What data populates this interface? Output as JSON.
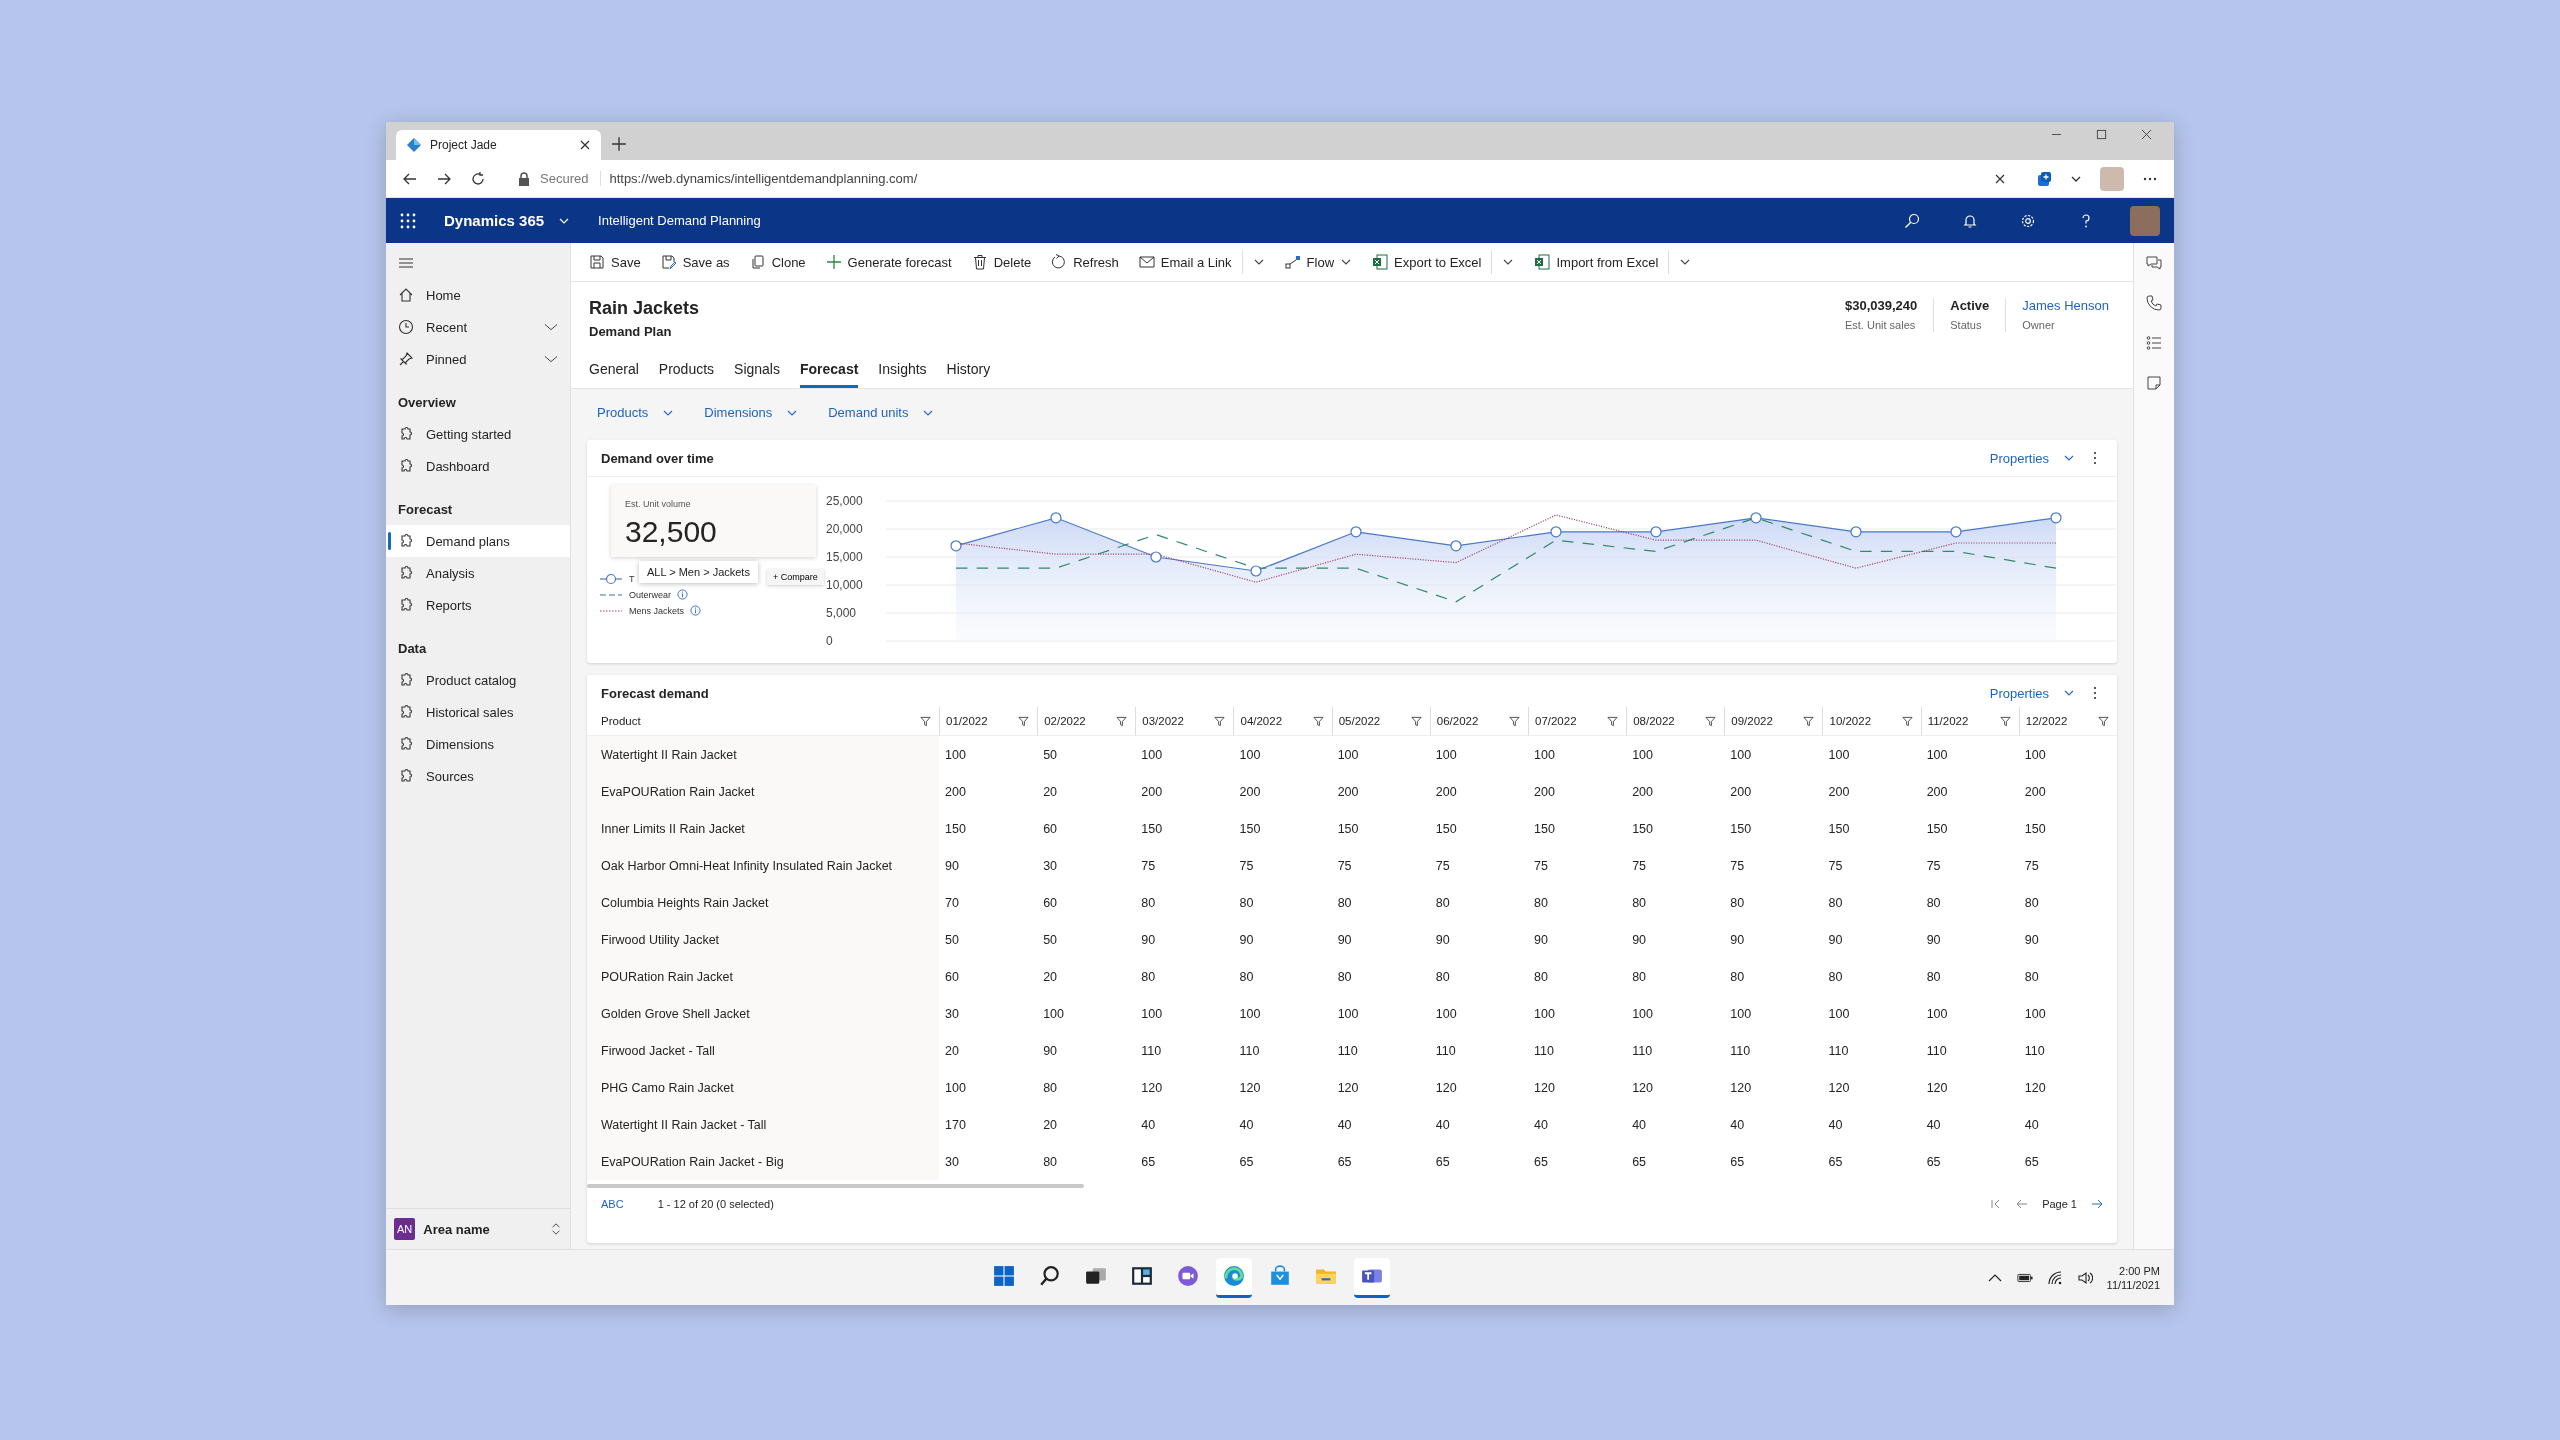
{
  "browser": {
    "tab_title": "Project Jade",
    "security": "Secured",
    "url": "https://web.dynamics/intelligentdemandplanning.com/"
  },
  "app_header": {
    "product": "Dynamics 365",
    "area": "Intelligent Demand Planning"
  },
  "toolbar": [
    {
      "kind": "save",
      "label": "Save"
    },
    {
      "kind": "save-as",
      "label": "Save as"
    },
    {
      "kind": "clone",
      "label": "Clone"
    },
    {
      "kind": "add",
      "label": "Generate forecast"
    },
    {
      "kind": "delete",
      "label": "Delete"
    },
    {
      "kind": "refresh",
      "label": "Refresh"
    },
    {
      "kind": "email",
      "label": "Email a Link",
      "split": true
    },
    {
      "kind": "flow",
      "label": "Flow",
      "dropdown": true
    },
    {
      "kind": "excel-export",
      "label": "Export to Excel",
      "split": true
    },
    {
      "kind": "excel-import",
      "label": "Import from Excel",
      "split": true
    }
  ],
  "sidebar": {
    "top": [
      {
        "kind": "home",
        "label": "Home"
      },
      {
        "kind": "recent",
        "label": "Recent",
        "expanded": false
      },
      {
        "kind": "pinned",
        "label": "Pinned",
        "expanded": false
      }
    ],
    "groups": [
      {
        "title": "Overview",
        "items": [
          {
            "label": "Getting started",
            "selected": false
          },
          {
            "label": "Dashboard",
            "selected": false
          }
        ]
      },
      {
        "title": "Forecast",
        "items": [
          {
            "label": "Demand plans",
            "selected": true
          },
          {
            "label": "Analysis",
            "selected": false
          },
          {
            "label": "Reports",
            "selected": false
          }
        ]
      },
      {
        "title": "Data",
        "items": [
          {
            "label": "Product catalog",
            "selected": false
          },
          {
            "label": "Historical sales",
            "selected": false
          },
          {
            "label": "Dimensions",
            "selected": false
          },
          {
            "label": "Sources",
            "selected": false
          }
        ]
      }
    ],
    "area": {
      "initials": "AN",
      "label": "Area name"
    }
  },
  "record": {
    "title": "Rain Jackets",
    "subtitle": "Demand Plan",
    "stats": [
      {
        "kind": "text",
        "value": "$30,039,240",
        "label": "Est. Unit sales"
      },
      {
        "kind": "text",
        "value": "Active",
        "label": "Status"
      },
      {
        "kind": "link",
        "value": "James Henson",
        "label": "Owner"
      }
    ]
  },
  "tabs": [
    {
      "label": "General",
      "selected": false
    },
    {
      "label": "Products",
      "selected": false
    },
    {
      "label": "Signals",
      "selected": false
    },
    {
      "label": "Forecast",
      "selected": true
    },
    {
      "label": "Insights",
      "selected": false
    },
    {
      "label": "History",
      "selected": false
    }
  ],
  "filters": [
    "Products",
    "Dimensions",
    "Demand units"
  ],
  "chart_card": {
    "title": "Demand over time",
    "properties": "Properties",
    "kpi": {
      "label": "Est. Unit volume",
      "value": "32,500"
    },
    "tooltip": "ALL > Men > Jackets",
    "compare": "+ Compare",
    "chart_data": {
      "type": "line",
      "grid": true,
      "ylim": [
        0,
        25000
      ],
      "yticks": [
        {
          "value": 0,
          "label": "0"
        },
        {
          "value": 5000,
          "label": "5,000"
        },
        {
          "value": 10000,
          "label": "10,000"
        },
        {
          "value": 15000,
          "label": "15,000"
        },
        {
          "value": 20000,
          "label": "20,000"
        },
        {
          "value": 25000,
          "label": "25,000"
        }
      ],
      "series": [
        {
          "name": "T",
          "color": "#4a78c9",
          "line_style": "solid",
          "marker": "circle",
          "values": [
            17000,
            22000,
            15000,
            12500,
            19500,
            17000,
            19500,
            19500,
            22000,
            19500,
            19500,
            22000
          ]
        },
        {
          "name": "Outerwear",
          "color": "#2e8a6a",
          "line_style": "dashed",
          "values": [
            13000,
            13000,
            19000,
            13000,
            13000,
            7000,
            18000,
            16000,
            22000,
            16000,
            16000,
            13000
          ]
        },
        {
          "name": "Mens Jackets",
          "color": "#a0406a",
          "line_style": "dotted",
          "values": [
            17500,
            15500,
            15500,
            10500,
            15500,
            14000,
            22500,
            18000,
            18000,
            13000,
            17500,
            17500
          ]
        }
      ]
    }
  },
  "table_card": {
    "title": "Forecast demand",
    "properties": "Properties",
    "columns": [
      "Product",
      "01/2022",
      "02/2022",
      "03/2022",
      "04/2022",
      "05/2022",
      "06/2022",
      "07/2022",
      "08/2022",
      "09/2022",
      "10/2022",
      "11/2022",
      "12/2022"
    ],
    "rows": [
      {
        "product": "Watertight II Rain Jacket",
        "values": [
          "100",
          "50",
          "100",
          "100",
          "100",
          "100",
          "100",
          "100",
          "100",
          "100",
          "100",
          "100"
        ]
      },
      {
        "product": "EvaPOURation Rain Jacket",
        "values": [
          "200",
          "20",
          "200",
          "200",
          "200",
          "200",
          "200",
          "200",
          "200",
          "200",
          "200",
          "200"
        ]
      },
      {
        "product": "Inner Limits II Rain Jacket",
        "values": [
          "150",
          "60",
          "150",
          "150",
          "150",
          "150",
          "150",
          "150",
          "150",
          "150",
          "150",
          "150"
        ]
      },
      {
        "product": "Oak Harbor Omni-Heat Infinity Insulated Rain Jacket",
        "values": [
          "90",
          "30",
          "75",
          "75",
          "75",
          "75",
          "75",
          "75",
          "75",
          "75",
          "75",
          "75"
        ]
      },
      {
        "product": "Columbia Heights Rain Jacket",
        "values": [
          "70",
          "60",
          "80",
          "80",
          "80",
          "80",
          "80",
          "80",
          "80",
          "80",
          "80",
          "80"
        ]
      },
      {
        "product": "Firwood Utility Jacket",
        "values": [
          "50",
          "50",
          "90",
          "90",
          "90",
          "90",
          "90",
          "90",
          "90",
          "90",
          "90",
          "90"
        ]
      },
      {
        "product": "POURation Rain Jacket",
        "values": [
          "60",
          "20",
          "80",
          "80",
          "80",
          "80",
          "80",
          "80",
          "80",
          "80",
          "80",
          "80"
        ]
      },
      {
        "product": "Golden Grove Shell Jacket",
        "values": [
          "30",
          "100",
          "100",
          "100",
          "100",
          "100",
          "100",
          "100",
          "100",
          "100",
          "100",
          "100"
        ]
      },
      {
        "product": "Firwood Jacket - Tall",
        "values": [
          "20",
          "90",
          "110",
          "110",
          "110",
          "110",
          "110",
          "110",
          "110",
          "110",
          "110",
          "110"
        ]
      },
      {
        "product": "PHG Camo Rain Jacket",
        "values": [
          "100",
          "80",
          "120",
          "120",
          "120",
          "120",
          "120",
          "120",
          "120",
          "120",
          "120",
          "120"
        ]
      },
      {
        "product": "Watertight II Rain Jacket - Tall",
        "values": [
          "170",
          "20",
          "40",
          "40",
          "40",
          "40",
          "40",
          "40",
          "40",
          "40",
          "40",
          "40"
        ]
      },
      {
        "product": "EvaPOURation Rain Jacket - Big",
        "values": [
          "30",
          "80",
          "65",
          "65",
          "65",
          "65",
          "65",
          "65",
          "65",
          "65",
          "65",
          "65"
        ]
      }
    ],
    "footer": {
      "view": "ABC",
      "count": "1 - 12 of 20 (0 selected)",
      "page": "Page 1"
    }
  },
  "taskbar": {
    "apps": [
      {
        "kind": "start",
        "active": false
      },
      {
        "kind": "search",
        "active": false
      },
      {
        "kind": "task-view",
        "active": false
      },
      {
        "kind": "widgets",
        "active": false
      },
      {
        "kind": "chat",
        "active": false
      },
      {
        "kind": "browser",
        "active": true
      },
      {
        "kind": "store",
        "active": false
      },
      {
        "kind": "folder",
        "active": false
      },
      {
        "kind": "teams",
        "active": true
      }
    ],
    "time": "2:00 PM",
    "date": "11/11/2021"
  }
}
